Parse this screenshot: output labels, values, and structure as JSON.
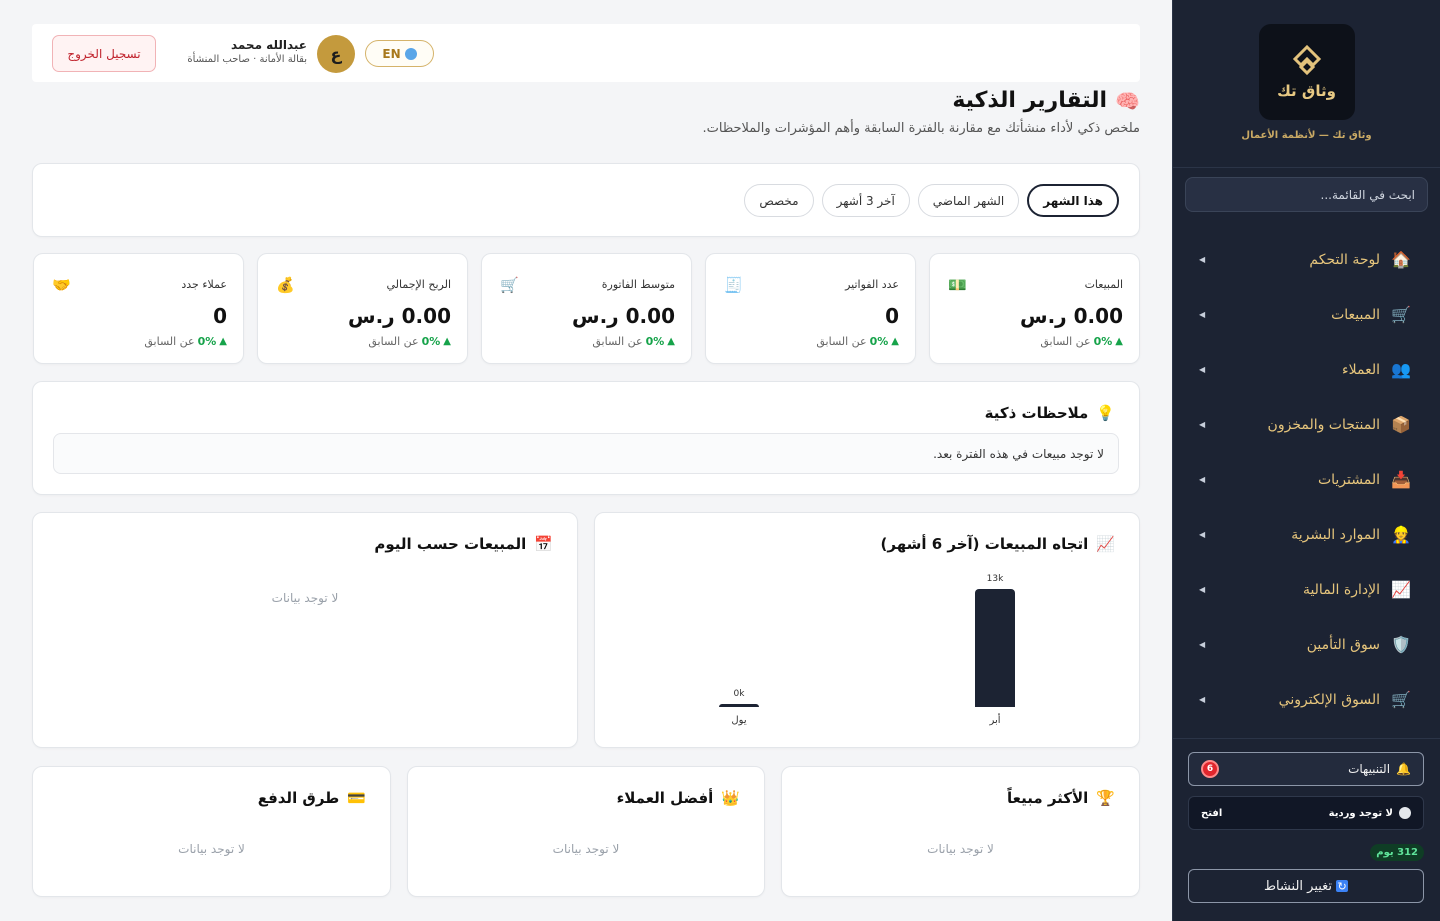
{
  "sidebar": {
    "brand_name": "وثاق تك",
    "brand_tagline": "وثاق تك — لأنظمة الأعمال",
    "search_placeholder": "ابحث في القائمة...",
    "items": [
      {
        "label": "لوحة التحكم",
        "icon": "🏠",
        "icon_name": "home-icon"
      },
      {
        "label": "المبيعات",
        "icon": "🛒",
        "icon_name": "cart-icon"
      },
      {
        "label": "العملاء",
        "icon": "👥",
        "icon_name": "users-icon"
      },
      {
        "label": "المنتجات والمخزون",
        "icon": "📦",
        "icon_name": "box-icon"
      },
      {
        "label": "المشتريات",
        "icon": "📥",
        "icon_name": "inbox-icon"
      },
      {
        "label": "الموارد البشرية",
        "icon": "👷",
        "icon_name": "worker-icon"
      },
      {
        "label": "الإدارة المالية",
        "icon": "📈",
        "icon_name": "chart-icon"
      },
      {
        "label": "سوق التأمين",
        "icon": "🛡️",
        "icon_name": "shield-icon"
      },
      {
        "label": "السوق الإلكتروني",
        "icon": "🛒",
        "icon_name": "market-cart-icon"
      }
    ],
    "notifications_label": "التنبيهات",
    "notifications_count": "6",
    "shift_label": "لا توجد وردية",
    "shift_open": "افتح",
    "days_badge": "312 يوم",
    "switch_label": "تغيير النشاط"
  },
  "topbar": {
    "logout_label": "تسجيل الخروج",
    "user_name": "عبدالله محمد",
    "user_role": "بقالة الأمانة · صاحب المنشأة",
    "avatar_letter": "ع",
    "lang_label": "EN"
  },
  "page": {
    "title": "التقارير الذكية",
    "subtitle": "ملخص ذكي لأداء منشأتك مع مقارنة بالفترة السابقة وأهم المؤشرات والملاحظات."
  },
  "filters": [
    "هذا الشهر",
    "الشهر الماضي",
    "آخر 3 أشهر",
    "مخصص"
  ],
  "kpis": [
    {
      "label": "المبيعات",
      "value": "0.00 ر.س",
      "icon": "💵",
      "delta": "0%",
      "delta_text": "عن السابق"
    },
    {
      "label": "عدد الفواتير",
      "value": "0",
      "icon": "🧾",
      "delta": "0%",
      "delta_text": "عن السابق"
    },
    {
      "label": "متوسط الفاتورة",
      "value": "0.00 ر.س",
      "icon": "🛒",
      "delta": "0%",
      "delta_text": "عن السابق"
    },
    {
      "label": "الربح الإجمالي",
      "value": "0.00 ر.س",
      "icon": "💰",
      "delta": "0%",
      "delta_text": "عن السابق"
    },
    {
      "label": "عملاء جدد",
      "value": "0",
      "icon": "🤝",
      "delta": "0%",
      "delta_text": "عن السابق"
    }
  ],
  "insights": {
    "title": "ملاحظات ذكية",
    "message": "لا توجد مبيعات في هذه الفترة بعد."
  },
  "trend": {
    "title": "اتجاه المبيعات (آخر 6 أشهر)"
  },
  "chart_data": {
    "type": "bar",
    "categories": [
      "أبر",
      "يول"
    ],
    "values": [
      13000,
      0
    ],
    "value_labels": [
      "13k",
      "0k"
    ],
    "ylim": [
      0,
      13000
    ]
  },
  "byday": {
    "title": "المبيعات حسب اليوم",
    "empty": "لا توجد بيانات"
  },
  "bottom": [
    {
      "title": "الأكثر مبيعاً",
      "icon": "🏆",
      "empty": "لا توجد بيانات"
    },
    {
      "title": "أفضل العملاء",
      "icon": "👑",
      "empty": "لا توجد بيانات"
    },
    {
      "title": "طرق الدفع",
      "icon": "💳",
      "empty": "لا توجد بيانات"
    }
  ]
}
